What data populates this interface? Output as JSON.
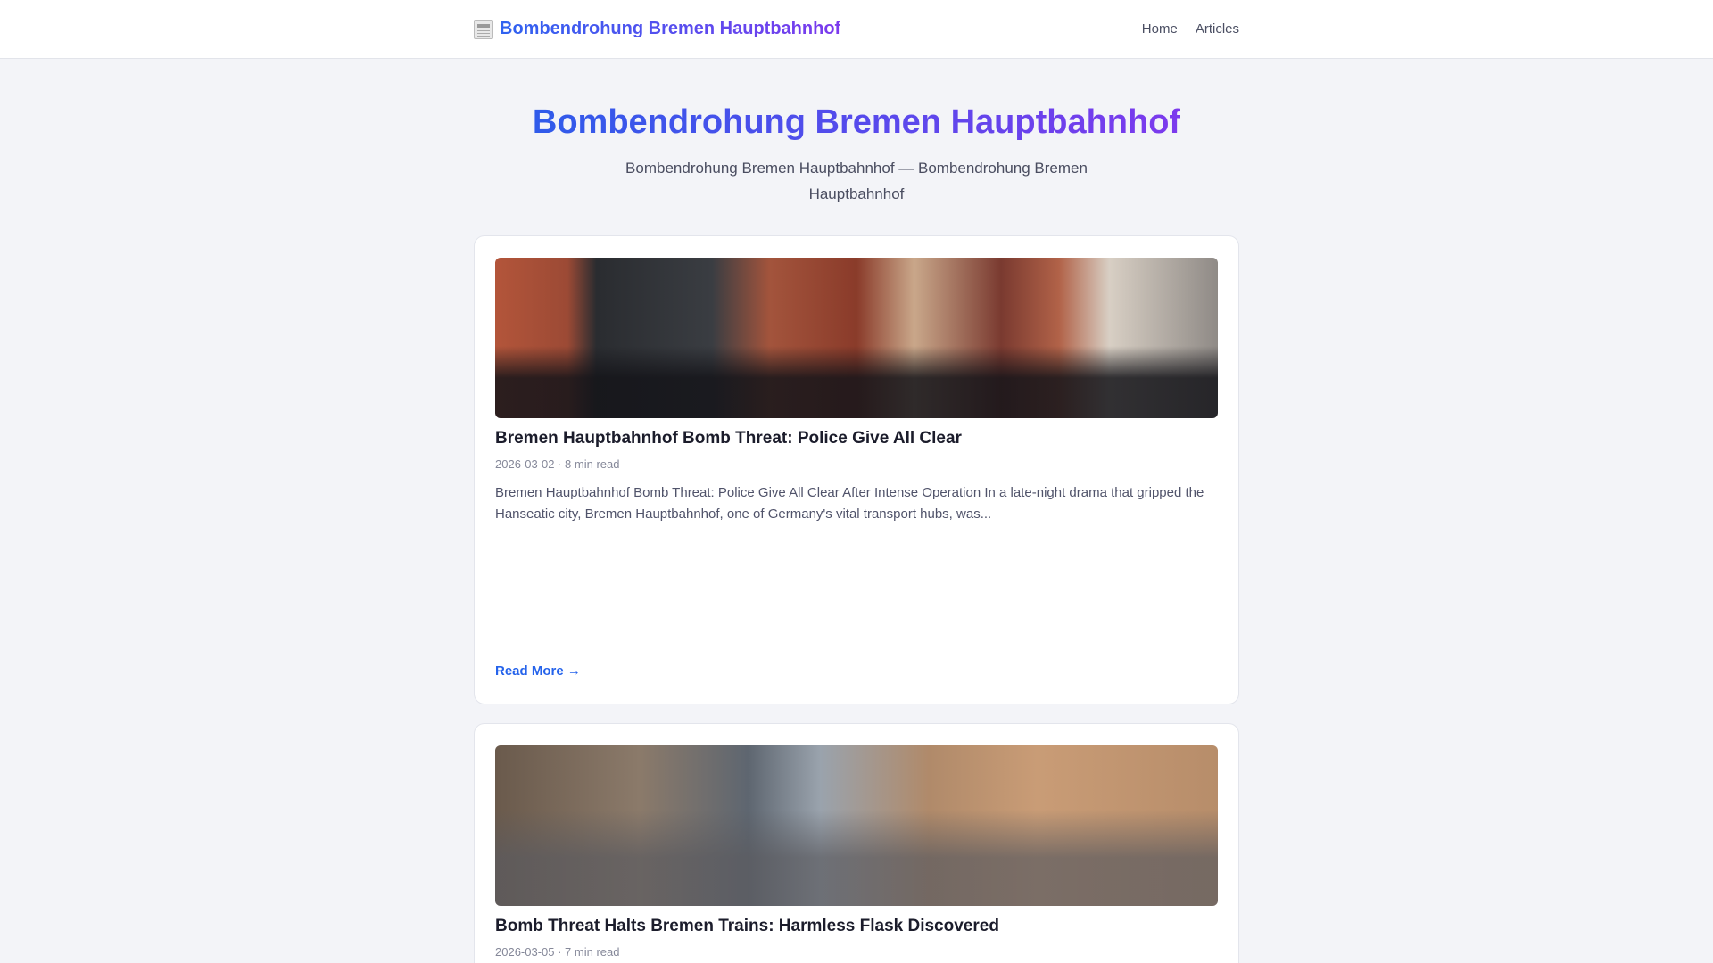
{
  "header": {
    "brand_icon": "newspaper-icon",
    "brand": "Bombendrohung Bremen Hauptbahnhof",
    "nav": [
      {
        "label": "Home"
      },
      {
        "label": "Articles"
      }
    ]
  },
  "hero": {
    "title": "Bombendrohung Bremen Hauptbahnhof",
    "subtitle": "Bombendrohung Bremen Hauptbahnhof — Bombendrohung Bremen Hauptbahnhof"
  },
  "articles": [
    {
      "title": "Bremen Hauptbahnhof Bomb Threat: Police Give All Clear",
      "meta": "2026-03-02 · 8 min read",
      "excerpt": "Bremen Hauptbahnhof Bomb Threat: Police Give All Clear After Intense Operation In a late-night drama that gripped the Hanseatic city, Bremen Hauptbahnhof, one of Germany's vital transport hubs, was...",
      "read_more": "Read More →"
    },
    {
      "title": "Bomb Threat Halts Bremen Trains: Harmless Flask Discovered",
      "meta": "2026-03-05 · 7 min read"
    }
  ]
}
